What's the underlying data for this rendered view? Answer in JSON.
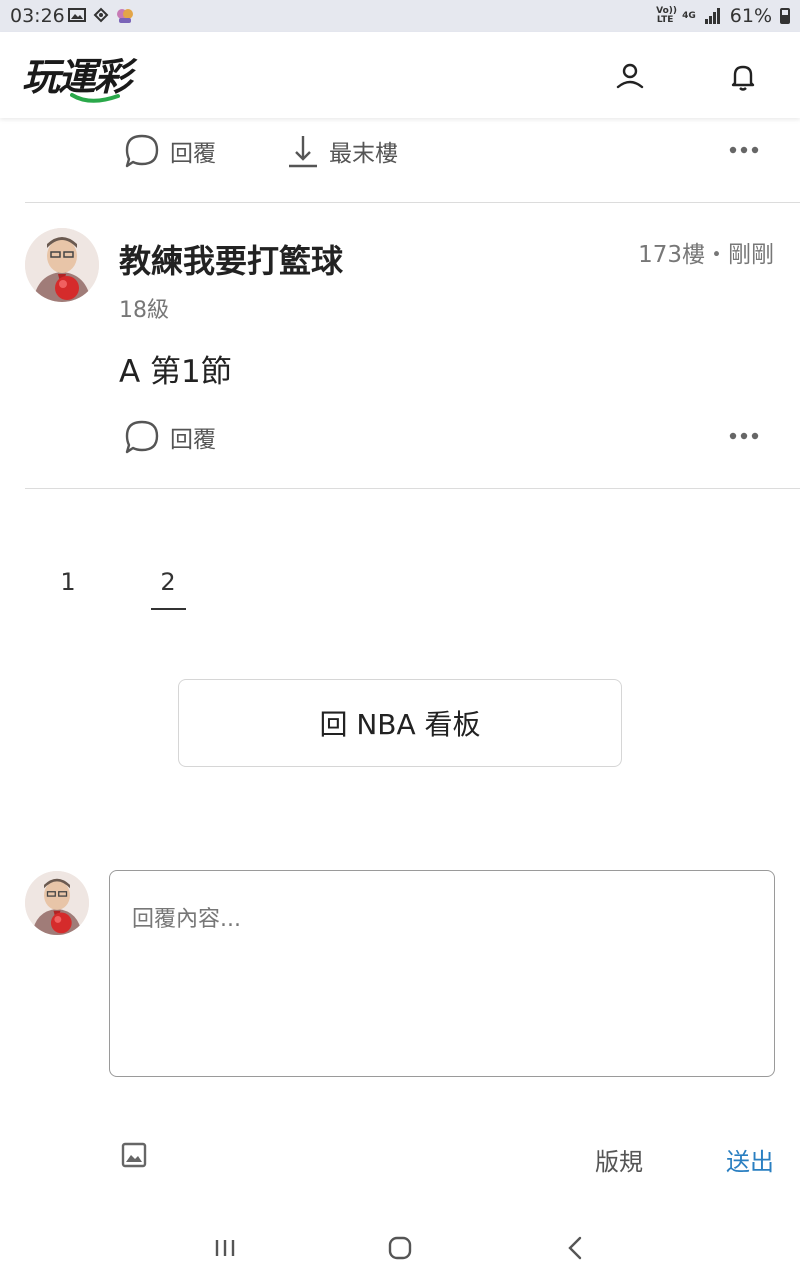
{
  "status_bar": {
    "time": "03:26",
    "volte_label": "Vo)) LTE",
    "network_label": "4G",
    "battery_percent": "61%"
  },
  "header": {
    "logo_text": "玩運彩",
    "logo_accent_color": "#2aa84a",
    "icons": [
      "user-icon",
      "bell-icon"
    ]
  },
  "prev_post_actions": {
    "reply_label": "回覆",
    "last_floor_label": "最末樓"
  },
  "post": {
    "username": "教練我要打籃球",
    "floor_time": "173樓・剛剛",
    "level": "18級",
    "content": "A 第1節",
    "reply_label": "回覆"
  },
  "pagination": {
    "pages": [
      "1",
      "2"
    ],
    "active_page": "2"
  },
  "back_to_board_label": "回 NBA 看板",
  "reply_form": {
    "placeholder": "回覆內容...",
    "rules_label": "版規",
    "send_label": "送出",
    "send_color": "#2a7fc1"
  }
}
